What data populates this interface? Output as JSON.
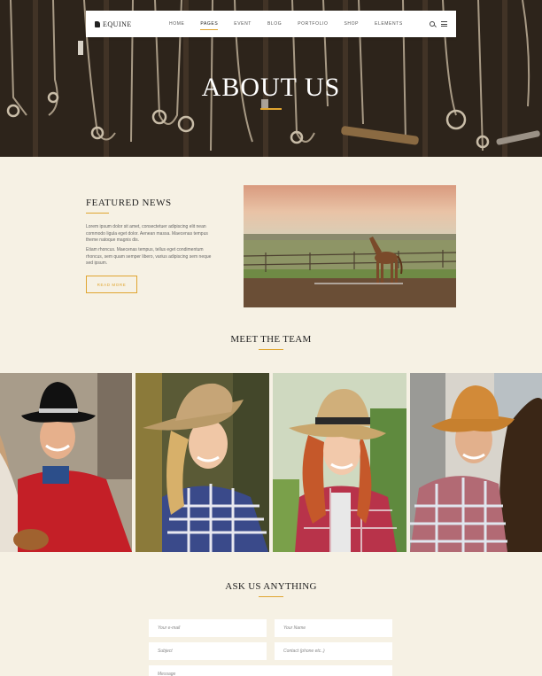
{
  "brand": {
    "name": "EQUINE"
  },
  "nav": {
    "items": [
      "HOME",
      "PAGES",
      "EVENT",
      "BLOG",
      "PORTFOLIO",
      "SHOP",
      "ELEMENTS"
    ],
    "active_index": 1,
    "icons": [
      "search-icon",
      "menu-icon"
    ]
  },
  "hero": {
    "title": "ABOUT US"
  },
  "featured": {
    "title": "FEATURED NEWS",
    "paragraph1": "Lorem ipsum dolor sit amet, consectetuer adipiscing elit nean commodo ligula eget dolor. Aenean massa. Maecenas tempus theme natoque magnis dis.",
    "paragraph2": "Etiam rhoncus. Maecenas tempus, tellus eget condimentum rhoncus, sem quam semper libero, varius adipiscing sem neque sed ipsum.",
    "button": "READ MORE"
  },
  "team": {
    "title": "MEET THE TEAM"
  },
  "contact": {
    "title": "ASK US ANYTHING",
    "placeholders": {
      "email": "Your e-mail",
      "name": "Your Name",
      "subject": "Subject",
      "contact": "Contact  (phone etc..)",
      "message": "Message"
    }
  },
  "colors": {
    "accent": "#e0a530",
    "background": "#f6f1e4",
    "text_dark": "#222222"
  }
}
